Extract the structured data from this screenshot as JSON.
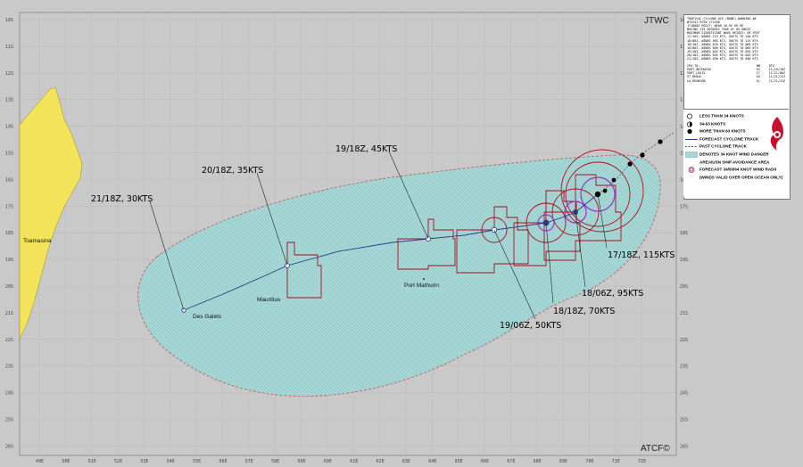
{
  "header": {
    "left_corner": "JTWC",
    "right_corner": "ATCF©"
  },
  "bulletin": {
    "lines": [
      "TROPICAL CYCLONE 02S (NONE) WARNING #6",
      "WTXS31 PGTW 172100",
      "171800Z POSIT: NEAR 16.9S 69.9E",
      "MOVING 235 DEGREES TRUE AT 05 KNOTS",
      "MAXIMUM SIGNIFICANT WAVE HEIGHT: 05 FEET",
      "17/18Z, WINDS 115 KTS, GUSTS TO 140 KTS",
      "18/06Z, WINDS 095 KTS, GUSTS TO 115 KTS",
      "18/18Z, WINDS 070 KTS, GUSTS TO 085 KTS",
      "19/06Z, WINDS 050 KTS, GUSTS TO 065 KTS",
      "19/18Z, WINDS 045 KTS, GUSTS TO 055 KTS",
      "20/18Z, WINDS 035 KTS, GUSTS TO 045 KTS",
      "21/18Z, WINDS 030 KTS, GUSTS TO 040 KTS"
    ],
    "cpa_header": [
      "CPA TO:",
      "NM",
      "DTG"
    ],
    "cpa_rows": [
      {
        "place": "PORT_MATHURIN",
        "nm": "95",
        "dtg": "11/19/18Z"
      },
      {
        "place": "PORT_LOUIS",
        "nm": "27",
        "dtg": "11/21/06Z"
      },
      {
        "place": "ST_DENIS",
        "nm": "30",
        "dtg": "11/21/12Z"
      },
      {
        "place": "LA_REUNION",
        "nm": "41",
        "dtg": "11/21/15Z"
      }
    ]
  },
  "legend": [
    {
      "text": "LESS THAN 34 KNOTS",
      "icon": "open-circle-icon"
    },
    {
      "text": "34-63 KNOTS",
      "icon": "half-circle-icon"
    },
    {
      "text": "MORE THAN 63 KNOTS",
      "icon": "hurricane-symbol-icon"
    },
    {
      "text": "FORECAST CYCLONE TRACK",
      "icon": "solid-line-icon"
    },
    {
      "text": "PAST CYCLONE TRACK",
      "icon": "dashed-line-icon"
    },
    {
      "text": "DENOTES 34 KNOT WIND DANGER",
      "icon": "danger-area-swatch"
    },
    {
      "text": "AREA/USN SHIP AVOIDANCE AREA",
      "icon": ""
    },
    {
      "text": "FORECAST 34/50/64 KNOT WIND RADII",
      "icon": "wind-radii-icon"
    },
    {
      "text": "(WINDS VALID OVER OPEN OCEAN ONLY)",
      "icon": ""
    }
  ],
  "forecast_labels": [
    {
      "text": "21/18Z, 30KTS",
      "lon": 54.8,
      "lat": 21.5
    },
    {
      "text": "20/18Z, 35KTS",
      "lon": 58.1,
      "lat": 20.6
    },
    {
      "text": "19/18Z, 45KTS",
      "lon": 63.6,
      "lat": 19.3
    },
    {
      "text": "19/06Z, 50KTS",
      "lon": 66.0,
      "lat": 19.1
    },
    {
      "text": "18/18Z, 70KTS",
      "lon": 67.8,
      "lat": 18.8
    },
    {
      "text": "18/06Z, 95KTS",
      "lon": 69.2,
      "lat": 18.2
    },
    {
      "text": "17/18Z, 115KTS",
      "lon": 69.9,
      "lat": 16.9
    }
  ],
  "places": [
    {
      "text": "Toamasina"
    },
    {
      "text": "Des Galets"
    },
    {
      "text": "Mauritius"
    },
    {
      "text": "Port Mathurin"
    }
  ],
  "lon_ticks": [
    "49E",
    "50E",
    "51E",
    "52E",
    "53E",
    "54E",
    "55E",
    "56E",
    "57E",
    "58E",
    "59E",
    "60E",
    "61E",
    "62E",
    "63E",
    "64E",
    "65E",
    "66E",
    "67E",
    "68E",
    "69E",
    "70E",
    "71E",
    "72E"
  ],
  "lat_ticks": [
    "10S",
    "11S",
    "12S",
    "13S",
    "14S",
    "15S",
    "16S",
    "17S",
    "18S",
    "19S",
    "20S",
    "21S",
    "22S",
    "23S",
    "24S",
    "25S",
    "26S"
  ],
  "colors": {
    "ocean": "#c9c9c9",
    "danger_area": "#a9d6d5",
    "radii": "#b01020",
    "radii_64": "#9a30c0",
    "track": "#2a3a8a",
    "land": "#f2e35a"
  }
}
